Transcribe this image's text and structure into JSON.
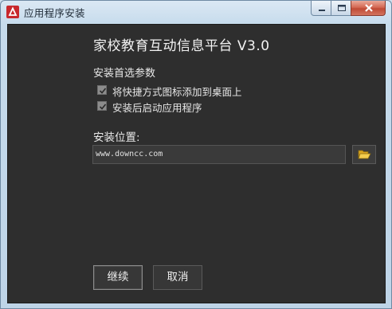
{
  "window": {
    "title": "应用程序安装",
    "icon": "app-installer-icon",
    "controls": [
      "minimize-icon",
      "maximize-icon",
      "close-icon"
    ]
  },
  "main": {
    "heading": "家校教育互动信息平台 V3.0",
    "options_label": "安装首选参数",
    "options": [
      {
        "label": "将快捷方式图标添加到桌面上",
        "checked": true
      },
      {
        "label": "安装后启动应用程序",
        "checked": true
      }
    ],
    "location_label": "安装位置:",
    "location_value": "www.downcc.com",
    "browse_icon": "folder-open-icon"
  },
  "buttons": {
    "continue_label": "继续",
    "cancel_label": "取消"
  },
  "colors": {
    "content_bg": "#2e2e2e",
    "accent_red": "#c8282d"
  }
}
